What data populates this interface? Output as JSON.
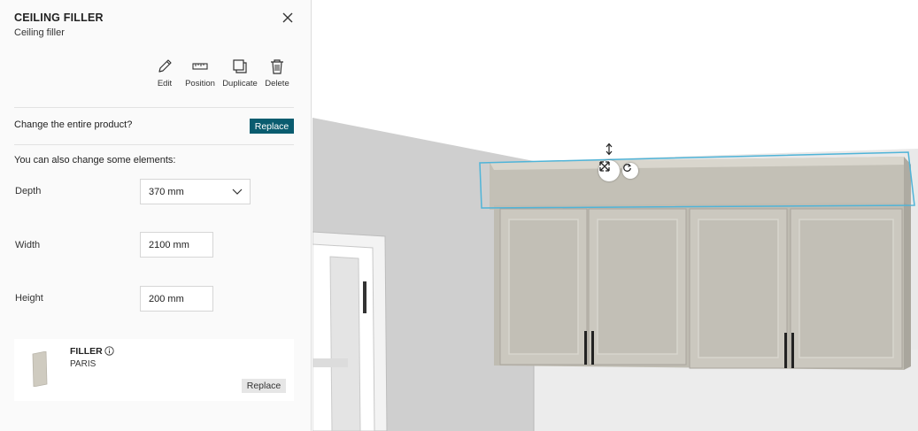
{
  "panel": {
    "title": "CEILING FILLER",
    "subtitle": "Ceiling filler",
    "actions": [
      {
        "label": "Edit",
        "icon": "pencil-icon"
      },
      {
        "label": "Position",
        "icon": "ruler-icon"
      },
      {
        "label": "Duplicate",
        "icon": "duplicate-icon"
      },
      {
        "label": "Delete",
        "icon": "trash-icon"
      }
    ],
    "change_question": "Change the entire product?",
    "replace_label": "Replace",
    "also_text": "You can also change some elements:",
    "fields": {
      "depth": {
        "label": "Depth",
        "value": "370 mm"
      },
      "width": {
        "label": "Width",
        "value": "2100 mm"
      },
      "height": {
        "label": "Height",
        "value": "200 mm"
      }
    },
    "card": {
      "name": "FILLER",
      "finish": "PARIS",
      "replace_label": "Replace"
    }
  },
  "colors": {
    "accent": "#0a5c6f",
    "selection_outline": "#4fb4d8",
    "cabinet": "#c9c6bd"
  }
}
